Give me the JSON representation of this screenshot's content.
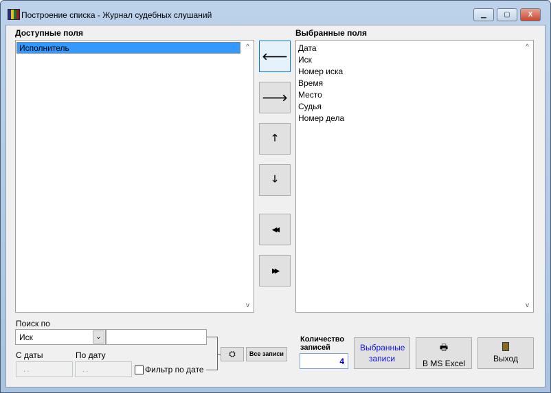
{
  "window": {
    "title": "Построение списка - Журнал судебных слушаний",
    "minimize": "▁",
    "maximize": "▢",
    "close": "X"
  },
  "available": {
    "label": "Доступные поля",
    "items": [
      "Исполнитель"
    ]
  },
  "selected": {
    "label": "Выбранные поля",
    "items": [
      "Дата",
      "Иск",
      "Номер иска",
      "Время",
      "Место",
      "Судья",
      "Номер дела"
    ]
  },
  "arrows": {
    "left": "🡐",
    "right": "🡒",
    "up": "🡑",
    "down": "🡓",
    "all_left": "◀◀",
    "all_right": "▶▶"
  },
  "search": {
    "label": "Поиск по",
    "field": "Иск",
    "value": "",
    "from_label": "С даты",
    "to_label": "По дату",
    "from_value": ". .",
    "to_value": ". .",
    "filter_label": "Фильтр по дате",
    "all_records": "Все записи"
  },
  "count": {
    "label": "Количество записей",
    "value": "4"
  },
  "buttons": {
    "selected_records": "Выбранные записи",
    "excel": "В MS Excel",
    "exit": "Выход"
  }
}
